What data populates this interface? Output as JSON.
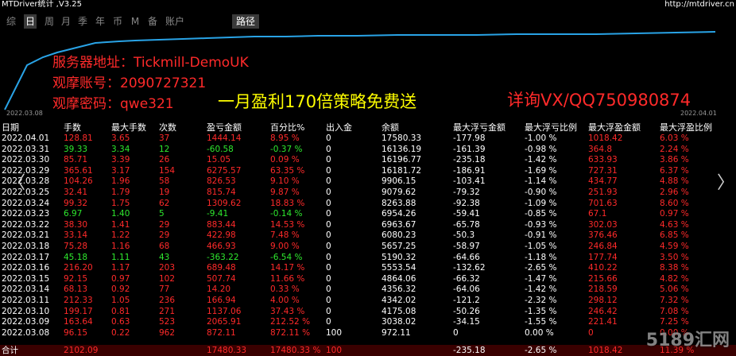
{
  "header": {
    "app_title": "MTDriver统计 ,V3.25",
    "site_url": "http://mtdriver.cn"
  },
  "tabs": [
    {
      "label": "综",
      "active": false
    },
    {
      "label": "日",
      "active": true
    },
    {
      "label": "周",
      "active": false
    },
    {
      "label": "月",
      "active": false
    },
    {
      "label": "季",
      "active": false
    },
    {
      "label": "年",
      "active": false
    },
    {
      "label": "币",
      "active": false
    },
    {
      "label": "M",
      "active": false
    },
    {
      "label": "备",
      "active": false
    },
    {
      "label": "账户",
      "active": false
    }
  ],
  "path_tab": "路径",
  "chart": {
    "start_date": "2022.03.08",
    "end_date": "2022.04.01",
    "line_color": "#29a3e6"
  },
  "overlay": {
    "server": "服务器地址：Tickmill-DemoUK",
    "account": "观摩账号：2090727321",
    "password": "观摩密码：qwe321",
    "slogan": "一月盈利170倍策略免费送",
    "contact": "详询VX/QQ750980874"
  },
  "columns": [
    "日期",
    "手数",
    "最大手数",
    "次数",
    "盈亏金额",
    "百分比%",
    "出入金",
    "余额",
    "最大浮亏金额",
    "最大浮亏比例",
    "最大浮盈金额",
    "最大浮盈比例"
  ],
  "rows": [
    [
      "2022.04.01",
      "128.81",
      "3.65",
      "37",
      "1444.14",
      "8.95 %",
      "0",
      "17580.33",
      "-177.98",
      "-1.00 %",
      "1018.42",
      "6.03 %"
    ],
    [
      "2022.03.31",
      "39.33",
      "3.34",
      "12",
      "-60.58",
      "-0.37 %",
      "0",
      "16136.19",
      "-161.39",
      "-0.98 %",
      "364.8",
      "2.24 %"
    ],
    [
      "2022.03.30",
      "85.71",
      "3.39",
      "26",
      "15.05",
      "0.09 %",
      "0",
      "16196.77",
      "-235.18",
      "-1.42 %",
      "633.93",
      "3.86 %"
    ],
    [
      "2022.03.29",
      "365.61",
      "3.17",
      "154",
      "6275.57",
      "63.35 %",
      "0",
      "16181.72",
      "-186.91",
      "-1.69 %",
      "727.31",
      "6.37 %"
    ],
    [
      "2022.03.28",
      "104.26",
      "1.96",
      "58",
      "826.53",
      "9.10 %",
      "0",
      "9906.15",
      "-103.41",
      "-1.14 %",
      "434.77",
      "4.88 %"
    ],
    [
      "2022.03.25",
      "32.41",
      "1.79",
      "19",
      "815.74",
      "9.87 %",
      "0",
      "9079.62",
      "-79.32",
      "-0.90 %",
      "251.93",
      "2.96 %"
    ],
    [
      "2022.03.24",
      "99.32",
      "1.75",
      "62",
      "1309.62",
      "18.83 %",
      "0",
      "8263.88",
      "-92.38",
      "-1.09 %",
      "701.63",
      "8.60 %"
    ],
    [
      "2022.03.23",
      "6.97",
      "1.40",
      "5",
      "-9.41",
      "-0.14 %",
      "0",
      "6954.26",
      "-59.41",
      "-0.85 %",
      "67.1",
      "0.97 %"
    ],
    [
      "2022.03.22",
      "38.30",
      "1.41",
      "29",
      "883.44",
      "14.53 %",
      "0",
      "6963.67",
      "-65.78",
      "-0.93 %",
      "302.03",
      "4.63 %"
    ],
    [
      "2022.03.21",
      "33.14",
      "1.22",
      "29",
      "422.98",
      "7.48 %",
      "0",
      "6080.23",
      "-50.3",
      "-0.91 %",
      "376.46",
      "6.85 %"
    ],
    [
      "2022.03.18",
      "75.28",
      "1.16",
      "68",
      "466.93",
      "9.00 %",
      "0",
      "5657.25",
      "-58.97",
      "-1.05 %",
      "246.84",
      "4.59 %"
    ],
    [
      "2022.03.17",
      "45.18",
      "1.11",
      "43",
      "-363.22",
      "-6.54 %",
      "0",
      "5190.32",
      "-64.66",
      "-1.18 %",
      "177.74",
      "3.50 %"
    ],
    [
      "2022.03.16",
      "216.20",
      "1.17",
      "203",
      "689.48",
      "14.17 %",
      "0",
      "5553.54",
      "-132.62",
      "-2.65 %",
      "410.22",
      "8.38 %"
    ],
    [
      "2022.03.15",
      "92.15",
      "0.97",
      "102",
      "507.74",
      "11.66 %",
      "0",
      "4864.06",
      "-66.32",
      "-1.47 %",
      "215.66",
      "4.82 %"
    ],
    [
      "2022.03.14",
      "68.13",
      "0.92",
      "77",
      "14.20",
      "0.33 %",
      "0",
      "4356.32",
      "-64.06",
      "-1.42 %",
      "218.59",
      "5.06 %"
    ],
    [
      "2022.03.11",
      "212.33",
      "1.05",
      "236",
      "166.94",
      "4.00 %",
      "0",
      "4342.02",
      "-121.2",
      "-2.32 %",
      "298.12",
      "7.32 %"
    ],
    [
      "2022.03.10",
      "199.17",
      "0.81",
      "271",
      "1137.06",
      "37.43 %",
      "0",
      "4175.08",
      "-50.26",
      "-1.35 %",
      "246.42",
      "7.08 %"
    ],
    [
      "2022.03.09",
      "163.64",
      "0.63",
      "523",
      "2065.91",
      "212.52 %",
      "0",
      "3038.02",
      "-34.15",
      "-1.55 %",
      "221.41",
      "7.25 %"
    ],
    [
      "2022.03.08",
      "96.15",
      "0.22",
      "962",
      "872.11",
      "872.11 %",
      "100",
      "972.11",
      "0",
      "0.00 %",
      "0",
      "0.00 %"
    ]
  ],
  "footer": [
    "合计",
    "2102.09",
    "",
    "",
    "17480.33",
    "17480.33 %",
    "100",
    "",
    "-235.18",
    "-2.65 %",
    "1018.42",
    "11.39 %"
  ],
  "watermark": "5189汇网",
  "nav": {
    "left": "〈",
    "right": "〉"
  }
}
